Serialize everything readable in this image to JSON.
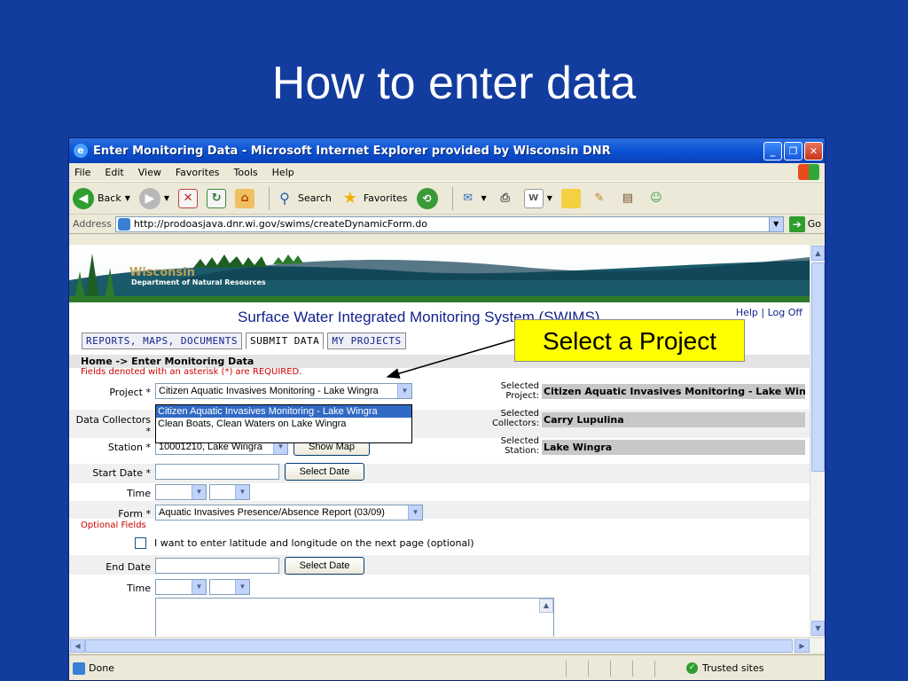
{
  "slide": {
    "title": "How to enter data"
  },
  "window": {
    "title": "Enter Monitoring Data - Microsoft Internet Explorer provided by Wisconsin DNR",
    "menu": [
      "File",
      "Edit",
      "View",
      "Favorites",
      "Tools",
      "Help"
    ],
    "toolbar": {
      "back": "Back",
      "search": "Search",
      "favorites": "Favorites"
    },
    "address_label": "Address",
    "address_value": "http://prodoasjava.dnr.wi.gov/swims/createDynamicForm.do",
    "go": "Go"
  },
  "page": {
    "banner": {
      "name": "Wisconsin",
      "dept": "Department of Natural Resources"
    },
    "header": "Surface Water Integrated Monitoring System (SWIMS)",
    "links": {
      "help": "Help",
      "sep": "|",
      "logoff": "Log Off"
    },
    "tabs": [
      "REPORTS, MAPS, DOCUMENTS",
      "SUBMIT DATA",
      "MY PROJECTS"
    ],
    "breadcrumb": "Home -> Enter Monitoring Data",
    "required_note": "Fields denoted with an asterisk (*) are REQUIRED.",
    "fields": {
      "project_label": "Project *",
      "project_value": "Citizen Aquatic Invasives Monitoring - Lake Wingra",
      "collectors_label": "Data Collectors *",
      "station_label": "Station *",
      "station_value": "10001210, Lake Wingra",
      "show_map": "Show Map",
      "start_date_label": "Start Date *",
      "select_date": "Select Date",
      "time_label": "Time",
      "form_label": "Form *",
      "form_value": "Aquatic Invasives Presence/Absence Report (03/09)",
      "optional_heading": "Optional Fields",
      "latlong_checkbox": "I want to enter latitude and longitude on the next page (optional)",
      "end_date_label": "End Date",
      "select_date_2": "Select Date",
      "time_label_2": "Time"
    },
    "dropdown_options": [
      "Citizen Aquatic Invasives Monitoring - Lake Wingra",
      "Clean Boats, Clean Waters on Lake Wingra"
    ],
    "selected": {
      "project_label": "Selected Project:",
      "project_value": "Citizen Aquatic Invasives Monitoring - Lake Wingra",
      "collectors_label": "Selected Collectors:",
      "collectors_value": "Carry Lupulina",
      "station_label": "Selected Station:",
      "station_value": "Lake Wingra"
    }
  },
  "status": {
    "left": "Done",
    "zone": "Trusted sites"
  },
  "callout": "Select a Project",
  "colors": {
    "slide_bg": "#123c9e",
    "callout_bg": "#ffff00",
    "link": "#13228c",
    "required": "#cc0000"
  }
}
